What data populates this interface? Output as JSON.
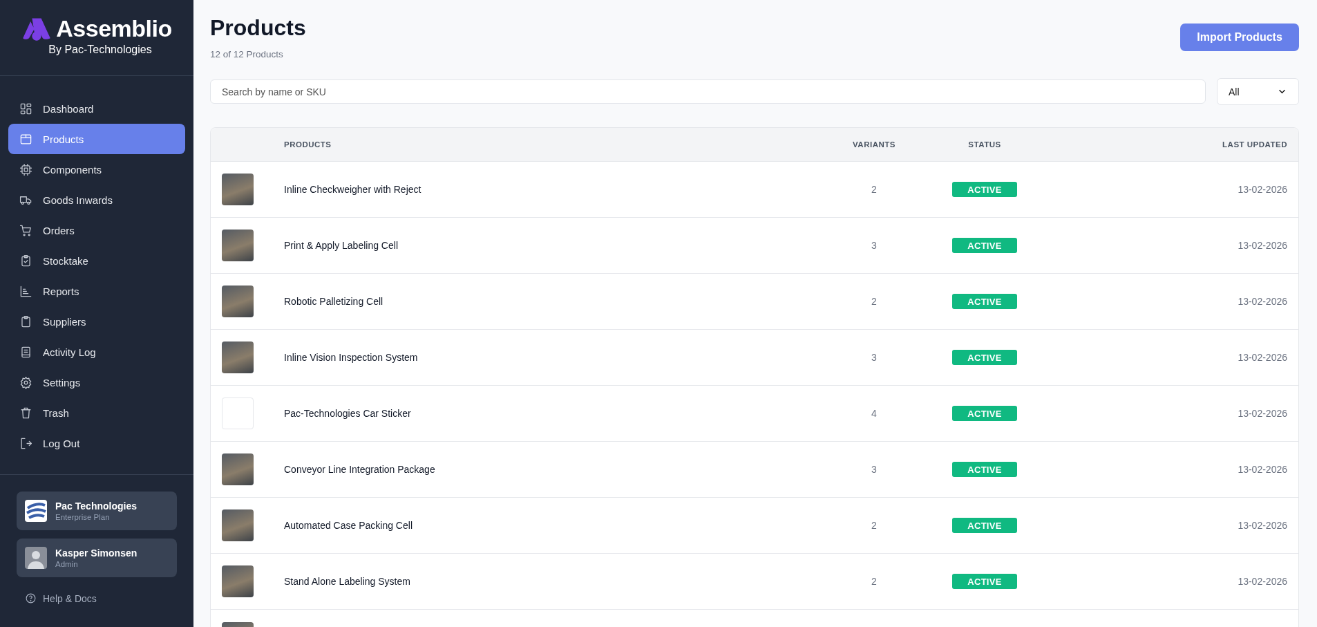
{
  "sidebar": {
    "brand": {
      "name": "Assemblio",
      "tagline": "By Pac-Technologies"
    },
    "items": [
      {
        "label": "Dashboard",
        "selected": false
      },
      {
        "label": "Products",
        "selected": true
      },
      {
        "label": "Components",
        "selected": false
      },
      {
        "label": "Goods Inwards",
        "selected": false
      },
      {
        "label": "Orders",
        "selected": false
      },
      {
        "label": "Stocktake",
        "selected": false
      },
      {
        "label": "Reports",
        "selected": false
      },
      {
        "label": "Suppliers",
        "selected": false
      },
      {
        "label": "Activity Log",
        "selected": false
      },
      {
        "label": "Settings",
        "selected": false
      },
      {
        "label": "Trash",
        "selected": false
      },
      {
        "label": "Log Out",
        "selected": false
      }
    ],
    "organization": {
      "name": "Pac Technologies",
      "plan": "Enterprise Plan"
    },
    "user": {
      "name": "Kasper Simonsen",
      "role": "Admin"
    },
    "help": "Help & Docs"
  },
  "header": {
    "title": "Products",
    "count": "12 of 12 Products",
    "import_button": "Import Products"
  },
  "search": {
    "placeholder": "Search by name or SKU"
  },
  "filter": {
    "value": "All"
  },
  "table": {
    "columns": [
      "PRODUCTS",
      "VARIANTS",
      "STATUS",
      "LAST UPDATED"
    ],
    "rows": [
      {
        "kind": "photo",
        "name": "Inline Checkweigher with Reject",
        "variants": "2",
        "status": "ACTIVE",
        "updated": "13-02-2026"
      },
      {
        "kind": "photo",
        "name": "Print & Apply Labeling Cell",
        "variants": "3",
        "status": "ACTIVE",
        "updated": "13-02-2026"
      },
      {
        "kind": "photo",
        "name": "Robotic Palletizing Cell",
        "variants": "2",
        "status": "ACTIVE",
        "updated": "13-02-2026"
      },
      {
        "kind": "photo",
        "name": "Inline Vision Inspection System",
        "variants": "3",
        "status": "ACTIVE",
        "updated": "13-02-2026"
      },
      {
        "kind": "logo",
        "name": "Pac-Technologies Car Sticker",
        "variants": "4",
        "status": "ACTIVE",
        "updated": "13-02-2026"
      },
      {
        "kind": "photo",
        "name": "Conveyor Line Integration Package",
        "variants": "3",
        "status": "ACTIVE",
        "updated": "13-02-2026"
      },
      {
        "kind": "photo",
        "name": "Automated Case Packing Cell",
        "variants": "2",
        "status": "ACTIVE",
        "updated": "13-02-2026"
      },
      {
        "kind": "photo",
        "name": "Stand Alone Labeling System",
        "variants": "2",
        "status": "ACTIVE",
        "updated": "13-02-2026"
      }
    ],
    "cut_row_thumbnail": true
  }
}
